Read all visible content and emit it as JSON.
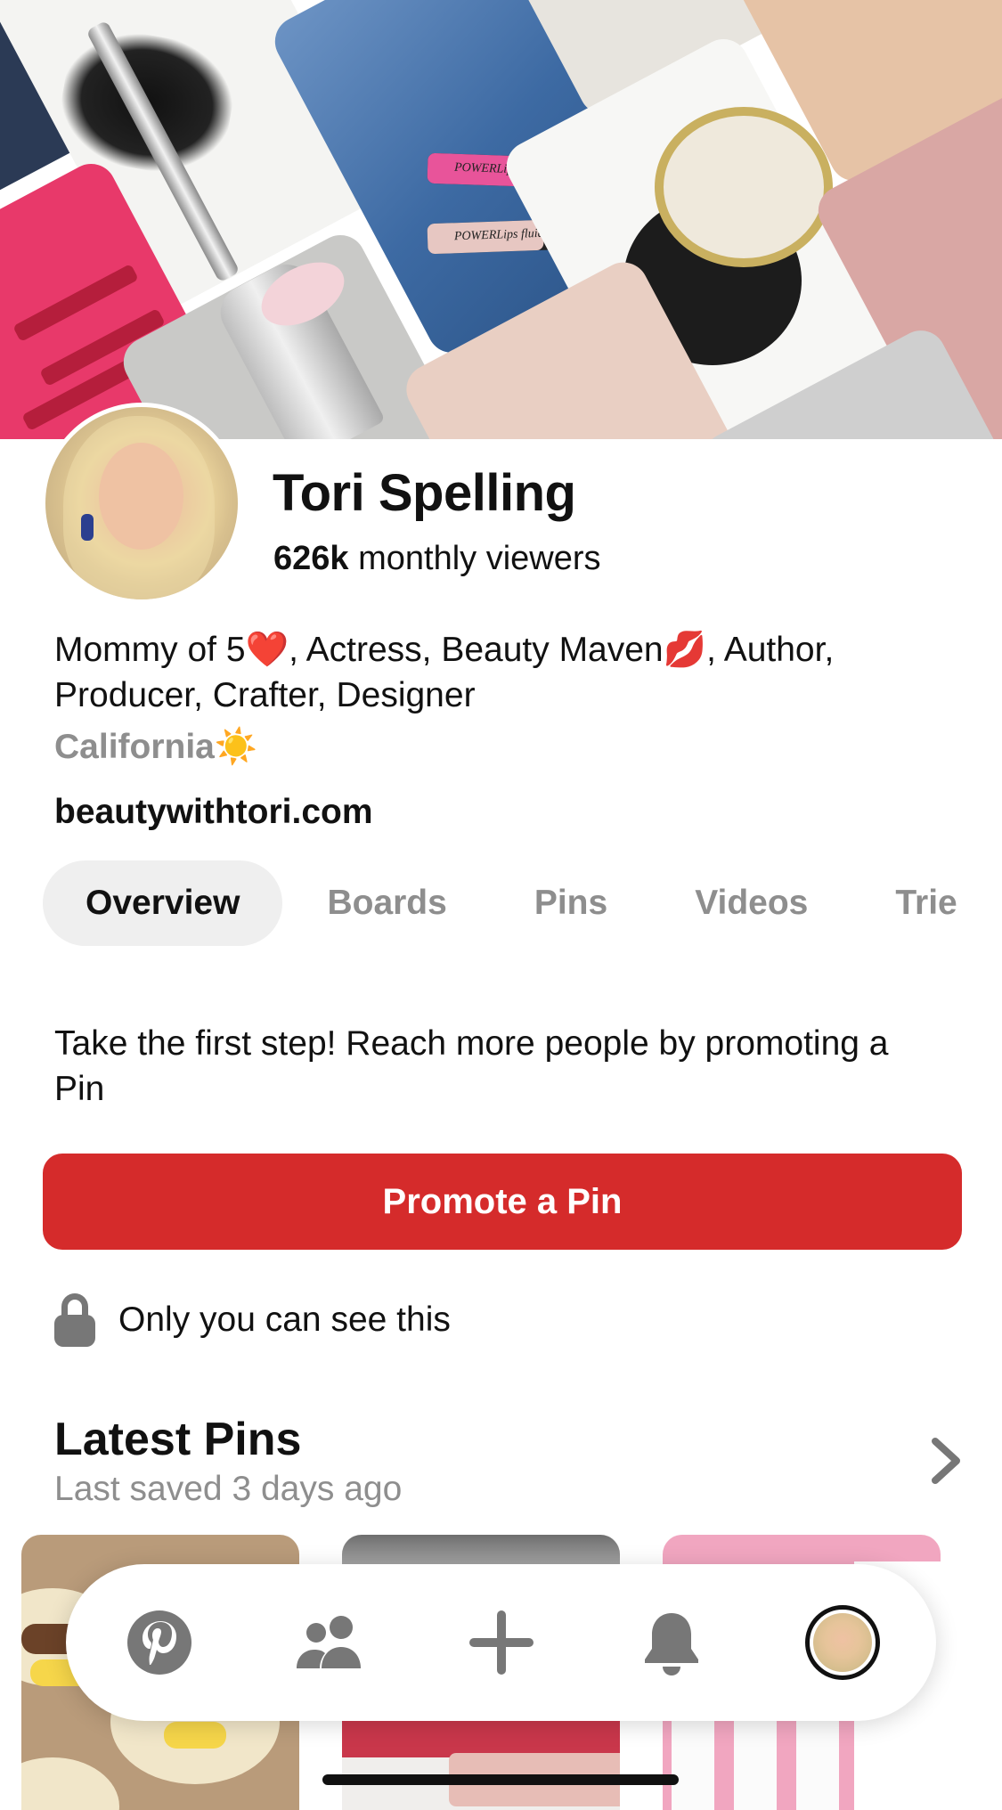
{
  "profile": {
    "name": "Tori Spelling",
    "viewer_count": "626k",
    "viewer_suffix": " monthly viewers",
    "bio": "Mommy of 5❤️, Actress, Beauty Maven💋, Author, Producer, Crafter, Designer",
    "location": "California☀️",
    "website": "beautywithtori.com"
  },
  "tabs": [
    {
      "label": "Overview",
      "active": true
    },
    {
      "label": "Boards",
      "active": false
    },
    {
      "label": "Pins",
      "active": false
    },
    {
      "label": "Videos",
      "active": false
    },
    {
      "label": "Trie",
      "active": false
    }
  ],
  "promote": {
    "message": "Take the first step! Reach more people by promoting a Pin",
    "button_label": "Promote a Pin",
    "privacy_note": "Only you can see this"
  },
  "latest_pins": {
    "title": "Latest Pins",
    "subtitle": "Last saved 3 days ago"
  },
  "cover": {
    "product_label": "POWERLips fluid"
  },
  "colors": {
    "accent_red": "#d52b2b",
    "muted_text": "#8e8e8e",
    "active_tab_bg": "#efefef",
    "icon_gray": "#777777"
  },
  "icons": {
    "nav": [
      "pinterest-logo-icon",
      "following-icon",
      "plus-icon",
      "bell-icon",
      "profile-avatar"
    ],
    "lock": "lock-icon",
    "more": "chevron-right-icon"
  }
}
